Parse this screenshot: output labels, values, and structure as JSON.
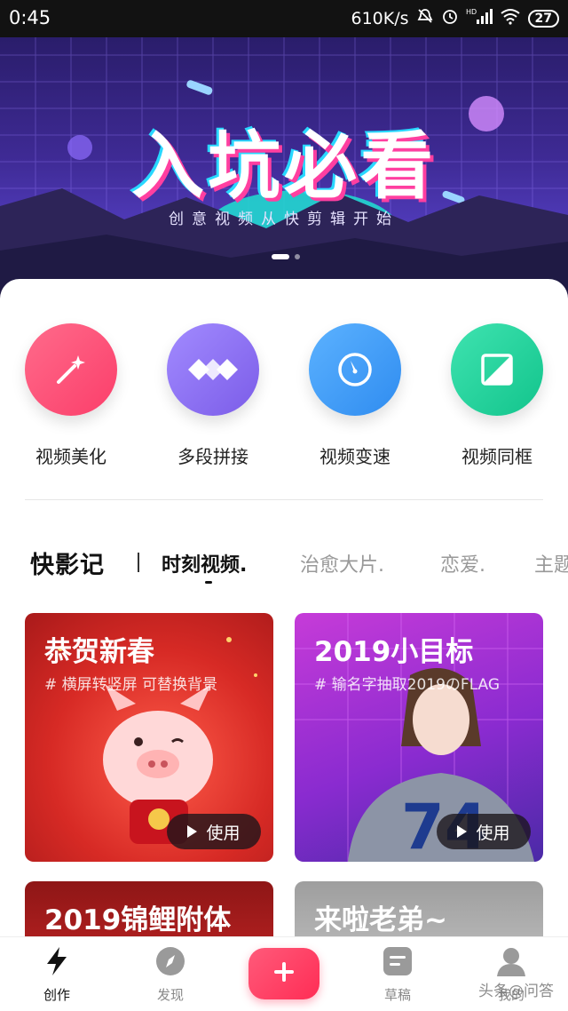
{
  "status_bar": {
    "time": "0:45",
    "network_speed": "610K/s",
    "signal_label": "HD",
    "battery": "27",
    "icons": [
      "mute-icon",
      "alarm-icon",
      "signal-icon",
      "wifi-icon",
      "battery-icon"
    ]
  },
  "banner": {
    "title": "入坑必看",
    "subtitle": "创意视频从快剪辑开始",
    "page_count": 2,
    "active_page": 1
  },
  "tools": [
    {
      "label": "视频美化",
      "icon": "magic-wand-icon",
      "color": "#fb3e6a"
    },
    {
      "label": "多段拼接",
      "icon": "diamonds-icon",
      "color": "#8a6cf2"
    },
    {
      "label": "视频变速",
      "icon": "compass-icon",
      "color": "#3b9bf5"
    },
    {
      "label": "视频同框",
      "icon": "split-square-icon",
      "color": "#1fd19a"
    }
  ],
  "tabs": {
    "logo": "快影记",
    "items": [
      "时刻视频.",
      "治愈大片.",
      "恋爱.",
      "主题"
    ],
    "active_index": 0
  },
  "cards": [
    {
      "title": "恭贺新春",
      "subtitle": "# 横屏转竖屏 可替换背景",
      "button": "使用"
    },
    {
      "title": "2019小目标",
      "subtitle": "# 输名字抽取2019のFLAG",
      "button": "使用"
    },
    {
      "title": "2019锦鲤附体"
    },
    {
      "title": "来啦老弟~"
    }
  ],
  "bottom_nav": {
    "items": [
      {
        "label": "创作",
        "icon": "lightning-icon",
        "active": true
      },
      {
        "label": "发现",
        "icon": "compass-nav-icon",
        "active": false
      },
      {
        "label": "草稿",
        "icon": "draft-icon",
        "active": false
      },
      {
        "label": "我的",
        "icon": "user-icon",
        "active": false
      }
    ],
    "add_icon": "plus-icon"
  },
  "watermark": "头条@问答",
  "colors": {
    "accent": "#ff2d55",
    "banner_bg": "#3e2a94"
  }
}
